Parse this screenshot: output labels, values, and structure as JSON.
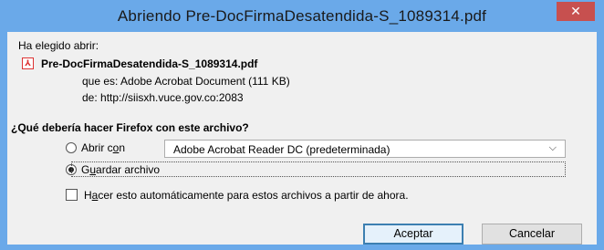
{
  "window": {
    "title": "Abriendo Pre-DocFirmaDesatendida-S_1089314.pdf",
    "close_icon": "close-icon"
  },
  "intro_label": "Ha elegido abrir:",
  "file": {
    "icon": "pdf-icon",
    "name": "Pre-DocFirmaDesatendida-S_1089314.pdf",
    "type_line": "que es:  Adobe Acrobat Document (111 KB)",
    "from_line": "de:  http://siisxh.vuce.gov.co:2083"
  },
  "question": "¿Qué debería hacer Firefox con este archivo?",
  "options": {
    "open_with": {
      "label_pre": "Abrir c",
      "label_key": "o",
      "label_post": "n",
      "checked": false
    },
    "app_select": {
      "value": "Adobe Acrobat Reader DC  (predeterminada)"
    },
    "save_file": {
      "label_pre": "G",
      "label_key": "u",
      "label_post": "ardar archivo",
      "checked": true
    }
  },
  "auto_checkbox": {
    "label_pre": "H",
    "label_key": "a",
    "label_post": "cer esto automáticamente para estos archivos a partir de ahora.",
    "checked": false
  },
  "buttons": {
    "accept": "Aceptar",
    "cancel": "Cancelar"
  }
}
